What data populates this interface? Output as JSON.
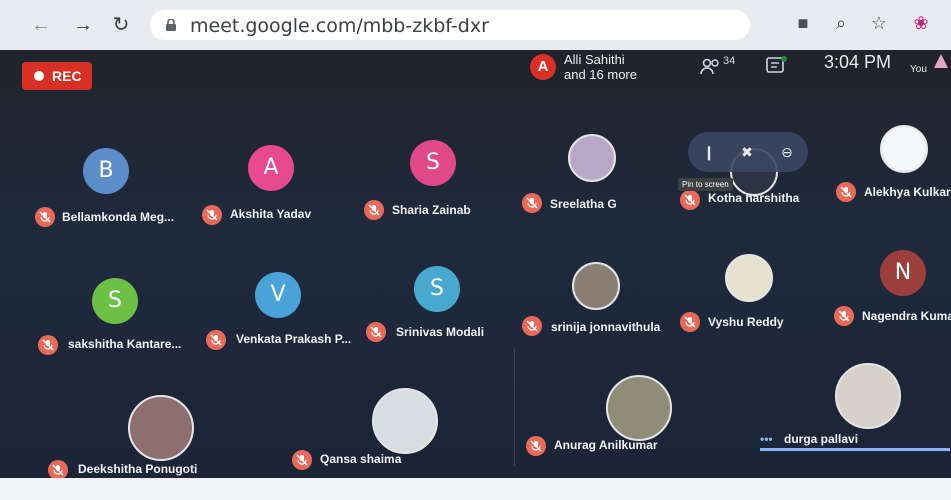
{
  "browser": {
    "url": "meet.google.com/mbb-zkbf-dxr"
  },
  "meeting": {
    "rec_label": "REC",
    "presenter_initial": "A",
    "presenter_line1": "Alli Sahithi",
    "presenter_line2": "and 16 more",
    "participant_count": "34",
    "time": "3:04 PM",
    "you_label": "You",
    "tooltip": "Pin to screen"
  },
  "participants": [
    {
      "initial": "B",
      "name": "Bellamkonda Meg...",
      "color": "#5b8ec9"
    },
    {
      "initial": "A",
      "name": "Akshita Yadav",
      "color": "#e84a8f"
    },
    {
      "initial": "S",
      "name": "Sharia Zainab",
      "color": "#e04888"
    },
    {
      "initial": "",
      "name": "Sreelatha G",
      "color": "#b9a7c8"
    },
    {
      "initial": "",
      "name": "Kotha harshitha",
      "color": "#2b3345"
    },
    {
      "initial": "",
      "name": "Alekhya Kulkarni",
      "color": "#f5f7fa"
    },
    {
      "initial": "S",
      "name": "sakshitha Kantare...",
      "color": "#6bc045"
    },
    {
      "initial": "V",
      "name": "Venkata Prakash P...",
      "color": "#4aa3d8"
    },
    {
      "initial": "S",
      "name": "Srinivas Modali",
      "color": "#48a9d0"
    },
    {
      "initial": "",
      "name": "srinija jonnavithula",
      "color": "#8a7e74"
    },
    {
      "initial": "",
      "name": "Vyshu Reddy",
      "color": "#e6e1cf"
    },
    {
      "initial": "N",
      "name": "Nagendra Kumar",
      "color": "#9c3f3a"
    },
    {
      "initial": "",
      "name": "Deekshitha Ponugoti",
      "color": "#8d6f70"
    },
    {
      "initial": "",
      "name": "Qansa shaima",
      "color": "#d9dde2"
    },
    {
      "initial": "",
      "name": "Anurag Anilkumar",
      "color": "#8f8d78"
    },
    {
      "initial": "",
      "name": "durga pallavi",
      "color": "#d7cfc9"
    }
  ]
}
